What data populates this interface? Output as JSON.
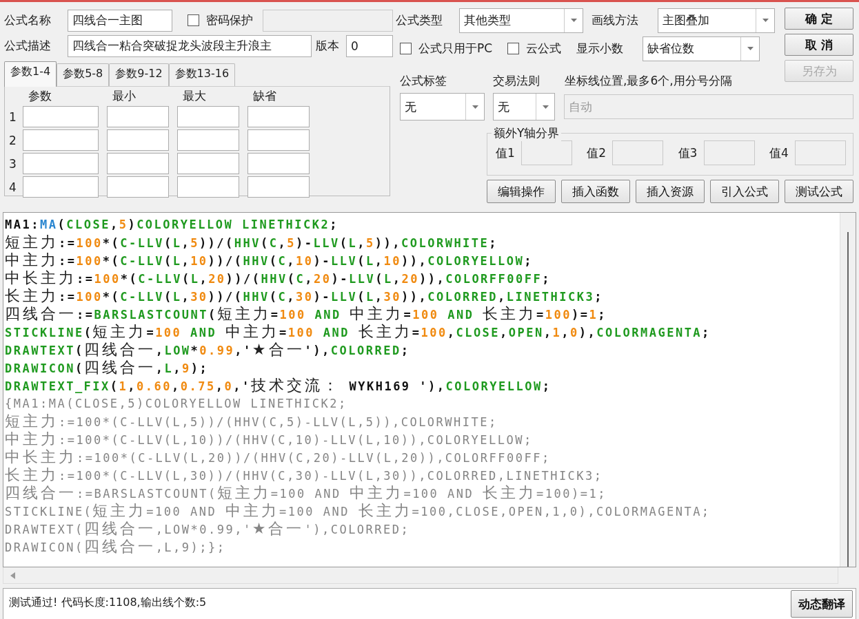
{
  "form": {
    "name_label": "公式名称",
    "name": "四线合一主图",
    "password": {
      "label": "密码保护",
      "checked": false
    },
    "desc_label": "公式描述",
    "desc": "四线合一粘合突破捉龙头波段主升浪主",
    "version_label": "版本",
    "version": "0"
  },
  "param_tabs": [
    {
      "label": "参数1-4",
      "selected": true
    },
    {
      "label": "参数5-8",
      "selected": false
    },
    {
      "label": "参数9-12",
      "selected": false
    },
    {
      "label": "参数13-16",
      "selected": false
    }
  ],
  "param_table": {
    "columns": [
      "参数",
      "最小",
      "最大",
      "缺省"
    ],
    "rows": [
      "1",
      "2",
      "3",
      "4"
    ]
  },
  "formula_type": {
    "label": "公式类型",
    "value": "其他类型"
  },
  "draw_method": {
    "label": "画线方法",
    "value": "主图叠加"
  },
  "options": [
    {
      "label": "公式只用于PC",
      "checked": false
    },
    {
      "label": "云公式",
      "checked": false
    }
  ],
  "decimals": {
    "label": "显示小数",
    "value": "缺省位数"
  },
  "buttons": [
    {
      "label": "确 定",
      "disabled": false
    },
    {
      "label": "取 消",
      "disabled": false
    },
    {
      "label": "另存为",
      "disabled": true
    }
  ],
  "tag": {
    "label": "公式标签",
    "value": "无"
  },
  "rule": {
    "label": "交易法则",
    "value": "无"
  },
  "axis": {
    "label": "坐标线位置,最多6个,用分号分隔",
    "placeholder": "自动",
    "disabled": true
  },
  "y_bounds": {
    "title": "额外Y轴分界",
    "fields": [
      "值1",
      "值2",
      "值3",
      "值4"
    ]
  },
  "actions": [
    "编辑操作",
    "插入函数",
    "插入资源",
    "引入公式",
    "测试公式"
  ],
  "code": [
    {
      "kind": "code",
      "tokens": [
        {
          "kind": "plain",
          "text": "MA1:"
        },
        {
          "kind": "function",
          "text": "MA"
        },
        {
          "kind": "plain",
          "text": "("
        },
        {
          "kind": "keyword",
          "text": "CLOSE"
        },
        {
          "kind": "plain",
          "text": ","
        },
        {
          "kind": "number",
          "text": "5"
        },
        {
          "kind": "plain",
          "text": ")"
        },
        {
          "kind": "keyword",
          "text": "COLORYELLOW LINETHICK2"
        },
        {
          "kind": "plain",
          "text": ";"
        }
      ]
    },
    {
      "kind": "code",
      "tokens": [
        {
          "kind": "name",
          "text": "短主力"
        },
        {
          "kind": "plain",
          "text": ":="
        },
        {
          "kind": "number",
          "text": "100"
        },
        {
          "kind": "plain",
          "text": "*("
        },
        {
          "kind": "keyword",
          "text": "C-LLV"
        },
        {
          "kind": "plain",
          "text": "("
        },
        {
          "kind": "keyword",
          "text": "L"
        },
        {
          "kind": "plain",
          "text": ","
        },
        {
          "kind": "number",
          "text": "5"
        },
        {
          "kind": "plain",
          "text": "))/("
        },
        {
          "kind": "keyword",
          "text": "HHV"
        },
        {
          "kind": "plain",
          "text": "("
        },
        {
          "kind": "keyword",
          "text": "C"
        },
        {
          "kind": "plain",
          "text": ","
        },
        {
          "kind": "number",
          "text": "5"
        },
        {
          "kind": "plain",
          "text": ")-"
        },
        {
          "kind": "keyword",
          "text": "LLV"
        },
        {
          "kind": "plain",
          "text": "("
        },
        {
          "kind": "keyword",
          "text": "L"
        },
        {
          "kind": "plain",
          "text": ","
        },
        {
          "kind": "number",
          "text": "5"
        },
        {
          "kind": "plain",
          "text": ")),"
        },
        {
          "kind": "keyword",
          "text": "COLORWHITE"
        },
        {
          "kind": "plain",
          "text": ";"
        }
      ]
    },
    {
      "kind": "code",
      "tokens": [
        {
          "kind": "name",
          "text": "中主力"
        },
        {
          "kind": "plain",
          "text": ":="
        },
        {
          "kind": "number",
          "text": "100"
        },
        {
          "kind": "plain",
          "text": "*("
        },
        {
          "kind": "keyword",
          "text": "C-LLV"
        },
        {
          "kind": "plain",
          "text": "("
        },
        {
          "kind": "keyword",
          "text": "L"
        },
        {
          "kind": "plain",
          "text": ","
        },
        {
          "kind": "number",
          "text": "10"
        },
        {
          "kind": "plain",
          "text": "))/("
        },
        {
          "kind": "keyword",
          "text": "HHV"
        },
        {
          "kind": "plain",
          "text": "("
        },
        {
          "kind": "keyword",
          "text": "C"
        },
        {
          "kind": "plain",
          "text": ","
        },
        {
          "kind": "number",
          "text": "10"
        },
        {
          "kind": "plain",
          "text": ")-"
        },
        {
          "kind": "keyword",
          "text": "LLV"
        },
        {
          "kind": "plain",
          "text": "("
        },
        {
          "kind": "keyword",
          "text": "L"
        },
        {
          "kind": "plain",
          "text": ","
        },
        {
          "kind": "number",
          "text": "10"
        },
        {
          "kind": "plain",
          "text": ")),"
        },
        {
          "kind": "keyword",
          "text": "COLORYELLOW"
        },
        {
          "kind": "plain",
          "text": ";"
        }
      ]
    },
    {
      "kind": "code",
      "tokens": [
        {
          "kind": "name",
          "text": "中长主力"
        },
        {
          "kind": "plain",
          "text": ":="
        },
        {
          "kind": "number",
          "text": "100"
        },
        {
          "kind": "plain",
          "text": "*("
        },
        {
          "kind": "keyword",
          "text": "C-LLV"
        },
        {
          "kind": "plain",
          "text": "("
        },
        {
          "kind": "keyword",
          "text": "L"
        },
        {
          "kind": "plain",
          "text": ","
        },
        {
          "kind": "number",
          "text": "20"
        },
        {
          "kind": "plain",
          "text": "))/("
        },
        {
          "kind": "keyword",
          "text": "HHV"
        },
        {
          "kind": "plain",
          "text": "("
        },
        {
          "kind": "keyword",
          "text": "C"
        },
        {
          "kind": "plain",
          "text": ","
        },
        {
          "kind": "number",
          "text": "20"
        },
        {
          "kind": "plain",
          "text": ")-"
        },
        {
          "kind": "keyword",
          "text": "LLV"
        },
        {
          "kind": "plain",
          "text": "("
        },
        {
          "kind": "keyword",
          "text": "L"
        },
        {
          "kind": "plain",
          "text": ","
        },
        {
          "kind": "number",
          "text": "20"
        },
        {
          "kind": "plain",
          "text": ")),"
        },
        {
          "kind": "keyword",
          "text": "COLORFF00FF"
        },
        {
          "kind": "plain",
          "text": ";"
        }
      ]
    },
    {
      "kind": "code",
      "tokens": [
        {
          "kind": "name",
          "text": "长主力"
        },
        {
          "kind": "plain",
          "text": ":="
        },
        {
          "kind": "number",
          "text": "100"
        },
        {
          "kind": "plain",
          "text": "*("
        },
        {
          "kind": "keyword",
          "text": "C-LLV"
        },
        {
          "kind": "plain",
          "text": "("
        },
        {
          "kind": "keyword",
          "text": "L"
        },
        {
          "kind": "plain",
          "text": ","
        },
        {
          "kind": "number",
          "text": "30"
        },
        {
          "kind": "plain",
          "text": "))/("
        },
        {
          "kind": "keyword",
          "text": "HHV"
        },
        {
          "kind": "plain",
          "text": "("
        },
        {
          "kind": "keyword",
          "text": "C"
        },
        {
          "kind": "plain",
          "text": ","
        },
        {
          "kind": "number",
          "text": "30"
        },
        {
          "kind": "plain",
          "text": ")-"
        },
        {
          "kind": "keyword",
          "text": "LLV"
        },
        {
          "kind": "plain",
          "text": "("
        },
        {
          "kind": "keyword",
          "text": "L"
        },
        {
          "kind": "plain",
          "text": ","
        },
        {
          "kind": "number",
          "text": "30"
        },
        {
          "kind": "plain",
          "text": ")),"
        },
        {
          "kind": "keyword",
          "text": "COLORRED"
        },
        {
          "kind": "plain",
          "text": ","
        },
        {
          "kind": "keyword",
          "text": "LINETHICK3"
        },
        {
          "kind": "plain",
          "text": ";"
        }
      ]
    },
    {
      "kind": "code",
      "tokens": [
        {
          "kind": "name",
          "text": "四线合一"
        },
        {
          "kind": "plain",
          "text": ":="
        },
        {
          "kind": "keyword",
          "text": "BARSLASTCOUNT"
        },
        {
          "kind": "plain",
          "text": "("
        },
        {
          "kind": "name",
          "text": "短主力"
        },
        {
          "kind": "plain",
          "text": "="
        },
        {
          "kind": "number",
          "text": "100"
        },
        {
          "kind": "keyword",
          "text": " AND "
        },
        {
          "kind": "name",
          "text": "中主力"
        },
        {
          "kind": "plain",
          "text": "="
        },
        {
          "kind": "number",
          "text": "100"
        },
        {
          "kind": "keyword",
          "text": " AND "
        },
        {
          "kind": "name",
          "text": "长主力"
        },
        {
          "kind": "plain",
          "text": "="
        },
        {
          "kind": "number",
          "text": "100"
        },
        {
          "kind": "plain",
          "text": ")="
        },
        {
          "kind": "number",
          "text": "1"
        },
        {
          "kind": "plain",
          "text": ";"
        }
      ]
    },
    {
      "kind": "code",
      "tokens": [
        {
          "kind": "keyword",
          "text": "STICKLINE"
        },
        {
          "kind": "plain",
          "text": "("
        },
        {
          "kind": "name",
          "text": "短主力"
        },
        {
          "kind": "plain",
          "text": "="
        },
        {
          "kind": "number",
          "text": "100"
        },
        {
          "kind": "keyword",
          "text": " AND "
        },
        {
          "kind": "name",
          "text": "中主力"
        },
        {
          "kind": "plain",
          "text": "="
        },
        {
          "kind": "number",
          "text": "100"
        },
        {
          "kind": "keyword",
          "text": " AND "
        },
        {
          "kind": "name",
          "text": "长主力"
        },
        {
          "kind": "plain",
          "text": "="
        },
        {
          "kind": "number",
          "text": "100"
        },
        {
          "kind": "plain",
          "text": ","
        },
        {
          "kind": "keyword",
          "text": "CLOSE"
        },
        {
          "kind": "plain",
          "text": ","
        },
        {
          "kind": "keyword",
          "text": "OPEN"
        },
        {
          "kind": "plain",
          "text": ","
        },
        {
          "kind": "number",
          "text": "1"
        },
        {
          "kind": "plain",
          "text": ","
        },
        {
          "kind": "number",
          "text": "0"
        },
        {
          "kind": "plain",
          "text": "),"
        },
        {
          "kind": "keyword",
          "text": "COLORMAGENTA"
        },
        {
          "kind": "plain",
          "text": ";"
        }
      ]
    },
    {
      "kind": "code",
      "tokens": [
        {
          "kind": "keyword",
          "text": "DRAWTEXT"
        },
        {
          "kind": "plain",
          "text": "("
        },
        {
          "kind": "name",
          "text": "四线合一"
        },
        {
          "kind": "plain",
          "text": ","
        },
        {
          "kind": "keyword",
          "text": "LOW"
        },
        {
          "kind": "plain",
          "text": "*"
        },
        {
          "kind": "number",
          "text": "0.99"
        },
        {
          "kind": "plain",
          "text": ",'"
        },
        {
          "kind": "name",
          "text": "★合一"
        },
        {
          "kind": "plain",
          "text": "'),"
        },
        {
          "kind": "keyword",
          "text": "COLORRED"
        },
        {
          "kind": "plain",
          "text": ";"
        }
      ]
    },
    {
      "kind": "code",
      "tokens": [
        {
          "kind": "keyword",
          "text": "DRAWICON"
        },
        {
          "kind": "plain",
          "text": "("
        },
        {
          "kind": "name",
          "text": "四线合一"
        },
        {
          "kind": "plain",
          "text": ","
        },
        {
          "kind": "keyword",
          "text": "L"
        },
        {
          "kind": "plain",
          "text": ","
        },
        {
          "kind": "number",
          "text": "9"
        },
        {
          "kind": "plain",
          "text": ");"
        }
      ]
    },
    {
      "kind": "code",
      "tokens": [
        {
          "kind": "keyword",
          "text": "DRAWTEXT_FIX"
        },
        {
          "kind": "plain",
          "text": "("
        },
        {
          "kind": "number",
          "text": "1"
        },
        {
          "kind": "plain",
          "text": ","
        },
        {
          "kind": "number",
          "text": "0.60"
        },
        {
          "kind": "plain",
          "text": ","
        },
        {
          "kind": "number",
          "text": "0.75"
        },
        {
          "kind": "plain",
          "text": ","
        },
        {
          "kind": "number",
          "text": "0"
        },
        {
          "kind": "plain",
          "text": ",'"
        },
        {
          "kind": "name",
          "text": "技术交流："
        },
        {
          "kind": "plain",
          "text": " WYKH169 '),"
        },
        {
          "kind": "keyword",
          "text": "COLORYELLOW"
        },
        {
          "kind": "plain",
          "text": ";"
        }
      ]
    },
    {
      "kind": "comment",
      "tokens": [
        {
          "kind": "plain",
          "text": "{MA1:MA(CLOSE,5)COLORYELLOW LINETHICK2;"
        }
      ]
    },
    {
      "kind": "comment",
      "tokens": [
        {
          "kind": "name",
          "text": "短主力"
        },
        {
          "kind": "plain",
          "text": ":=100*(C-LLV(L,5))/(HHV(C,5)-LLV(L,5)),COLORWHITE;"
        }
      ]
    },
    {
      "kind": "comment",
      "tokens": [
        {
          "kind": "name",
          "text": "中主力"
        },
        {
          "kind": "plain",
          "text": ":=100*(C-LLV(L,10))/(HHV(C,10)-LLV(L,10)),COLORYELLOW;"
        }
      ]
    },
    {
      "kind": "comment",
      "tokens": [
        {
          "kind": "name",
          "text": "中长主力"
        },
        {
          "kind": "plain",
          "text": ":=100*(C-LLV(L,20))/(HHV(C,20)-LLV(L,20)),COLORFF00FF;"
        }
      ]
    },
    {
      "kind": "comment",
      "tokens": [
        {
          "kind": "name",
          "text": "长主力"
        },
        {
          "kind": "plain",
          "text": ":=100*(C-LLV(L,30))/(HHV(C,30)-LLV(L,30)),COLORRED,LINETHICK3;"
        }
      ]
    },
    {
      "kind": "comment",
      "tokens": [
        {
          "kind": "name",
          "text": "四线合一"
        },
        {
          "kind": "plain",
          "text": ":=BARSLASTCOUNT("
        },
        {
          "kind": "name",
          "text": "短主力"
        },
        {
          "kind": "plain",
          "text": "=100 AND "
        },
        {
          "kind": "name",
          "text": "中主力"
        },
        {
          "kind": "plain",
          "text": "=100 AND "
        },
        {
          "kind": "name",
          "text": "长主力"
        },
        {
          "kind": "plain",
          "text": "=100)=1;"
        }
      ]
    },
    {
      "kind": "comment",
      "tokens": [
        {
          "kind": "plain",
          "text": "STICKLINE("
        },
        {
          "kind": "name",
          "text": "短主力"
        },
        {
          "kind": "plain",
          "text": "=100 AND "
        },
        {
          "kind": "name",
          "text": "中主力"
        },
        {
          "kind": "plain",
          "text": "=100 AND "
        },
        {
          "kind": "name",
          "text": "长主力"
        },
        {
          "kind": "plain",
          "text": "=100,CLOSE,OPEN,1,0),COLORMAGENTA;"
        }
      ]
    },
    {
      "kind": "comment",
      "tokens": [
        {
          "kind": "plain",
          "text": "DRAWTEXT("
        },
        {
          "kind": "name",
          "text": "四线合一"
        },
        {
          "kind": "plain",
          "text": ",LOW*0.99,'"
        },
        {
          "kind": "name",
          "text": "★合一"
        },
        {
          "kind": "plain",
          "text": "'),COLORRED;"
        }
      ]
    },
    {
      "kind": "comment",
      "tokens": [
        {
          "kind": "plain",
          "text": "DRAWICON("
        },
        {
          "kind": "name",
          "text": "四线合一"
        },
        {
          "kind": "plain",
          "text": ",L,9);};"
        }
      ]
    }
  ],
  "status": "测试通过! 代码长度:1108,输出线个数:5",
  "translate_button": "动态翻译"
}
